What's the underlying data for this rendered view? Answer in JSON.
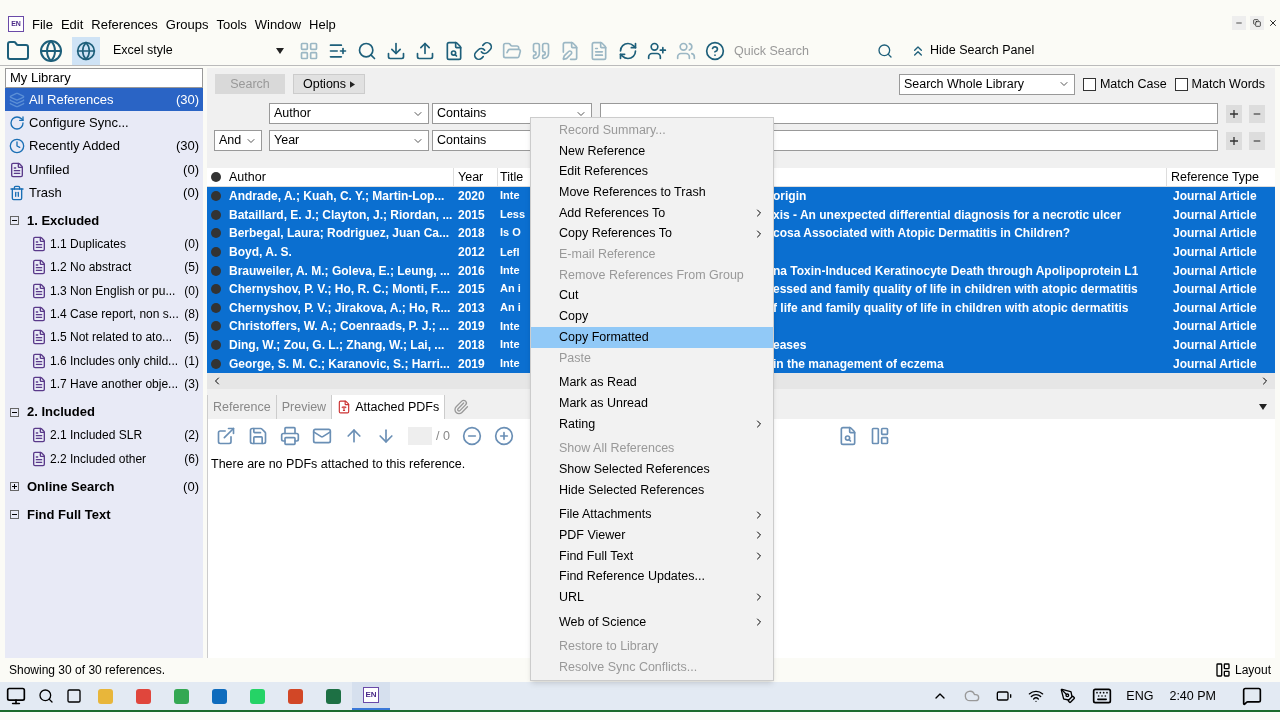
{
  "app_icon": "EN",
  "menu": [
    "File",
    "Edit",
    "References",
    "Groups",
    "Tools",
    "Window",
    "Help"
  ],
  "toolbar": {
    "style": "Excel style",
    "quick_search_placeholder": "Quick Search",
    "hide_search_panel": "Hide Search Panel"
  },
  "sidebar": {
    "header": "My Library",
    "items": [
      {
        "kind": "all",
        "label": "All References",
        "count": "(30)",
        "selected": true
      },
      {
        "kind": "sync",
        "label": "Configure Sync...",
        "selected": false
      },
      {
        "kind": "recent",
        "label": "Recently Added",
        "count": "(30)",
        "selected": false
      },
      {
        "kind": "unfiled",
        "label": "Unfiled",
        "count": "(0)",
        "selected": false
      },
      {
        "kind": "trash",
        "label": "Trash",
        "count": "(0)",
        "selected": false
      },
      {
        "kind": "set",
        "label": "1. Excluded",
        "expanded": true,
        "children": [
          {
            "label": "1.1 Duplicates",
            "count": "(0)"
          },
          {
            "label": "1.2 No abstract",
            "count": "(5)"
          },
          {
            "label": "1.3 Non English or pu...",
            "count": "(0)"
          },
          {
            "label": "1.4 Case report, non s...",
            "count": "(8)"
          },
          {
            "label": "1.5 Not related to ato...",
            "count": "(5)"
          },
          {
            "label": "1.6 Includes only child...",
            "count": "(1)"
          },
          {
            "label": "1.7 Have another obje...",
            "count": "(3)"
          }
        ]
      },
      {
        "kind": "set",
        "label": "2. Included",
        "expanded": true,
        "children": [
          {
            "label": "2.1 Included SLR",
            "count": "(2)"
          },
          {
            "label": "2.2 Included other",
            "count": "(6)"
          }
        ]
      },
      {
        "kind": "set",
        "label": "Online Search",
        "count": "(0)",
        "expanded": false
      },
      {
        "kind": "set",
        "label": "Find Full Text",
        "expanded": true
      }
    ]
  },
  "search_panel": {
    "search_button": "Search",
    "options_button": "Options",
    "scope": "Search Whole Library",
    "match_case": {
      "label": "Match Case",
      "checked": false
    },
    "match_words": {
      "label": "Match Words",
      "checked": false
    },
    "criteria": [
      {
        "field": "Author",
        "operator": "Contains"
      },
      {
        "connector": "And",
        "field": "Year",
        "operator": "Contains"
      }
    ]
  },
  "table": {
    "columns": [
      "Author",
      "Year",
      "Title",
      "Reference Type"
    ],
    "rows": [
      {
        "author": "Andrade, A.; Kuah, C. Y.; Martin-Lop...",
        "year": "2020",
        "title_start": "Inte",
        "title_end": "origin",
        "type": "Journal Article",
        "selected": true
      },
      {
        "author": "Bataillard, E. J.; Clayton, J.; Riordan, ...",
        "year": "2015",
        "title_start": "Less",
        "title_end": "xis - An unexpected differential diagnosis for a necrotic ulcer",
        "type": "Journal Article",
        "selected": true
      },
      {
        "author": "Berbegal, Laura; Rodriguez, Juan Ca...",
        "year": "2018",
        "title_start": "Is O",
        "title_end": "cosa Associated with Atopic Dermatitis in Children?",
        "type": "Journal Article",
        "selected": true
      },
      {
        "author": "Boyd, A. S.",
        "year": "2012",
        "title_start": "Lefl",
        "type": "Journal Article",
        "selected": true
      },
      {
        "author": "Brauweiler, A. M.; Goleva, E.; Leung, ...",
        "year": "2016",
        "title_start": "Inte",
        "title_end": "na Toxin-Induced Keratinocyte Death through Apolipoprotein L1",
        "type": "Journal Article",
        "selected": true
      },
      {
        "author": "Chernyshov, P. V.; Ho, R. C.; Monti, F....",
        "year": "2015",
        "title_start": "An i",
        "title_end": "essed and family quality of life in children with atopic dermatitis",
        "type": "Journal Article",
        "selected": true
      },
      {
        "author": "Chernyshov, P. V.; Jirakova, A.; Ho, R...",
        "year": "2013",
        "title_start": "An i",
        "title_end": "f life and family quality of life in children with atopic dermatitis",
        "type": "Journal Article",
        "selected": true
      },
      {
        "author": "Christoffers, W. A.; Coenraads, P. J.; ...",
        "year": "2019",
        "title_start": "Inte",
        "type": "Journal Article",
        "selected": true
      },
      {
        "author": "Ding, W.; Zou, G. L.; Zhang, W.; Lai, ...",
        "year": "2018",
        "title_start": "Inte",
        "title_end": "eases",
        "type": "Journal Article",
        "selected": true
      },
      {
        "author": "George, S. M. C.; Karanovic, S.; Harri...",
        "year": "2019",
        "title_start": "Inte",
        "title_end": "in the management of eczema",
        "type": "Journal Article",
        "selected": true
      }
    ]
  },
  "bottom_tabs": [
    {
      "label": "Reference",
      "selected": false
    },
    {
      "label": "Preview",
      "selected": false
    },
    {
      "label": "Attached PDFs",
      "selected": true
    }
  ],
  "pdf_page": "/ 0",
  "pdf_message": "There are no PDFs attached to this reference.",
  "context_menu": [
    {
      "kind": "item",
      "label": "Record Summary...",
      "disabled": true
    },
    {
      "kind": "item",
      "label": "New Reference"
    },
    {
      "kind": "item",
      "label": "Edit References"
    },
    {
      "kind": "item",
      "label": "Move References to Trash"
    },
    {
      "kind": "item",
      "label": "Add References To",
      "submenu": true
    },
    {
      "kind": "item",
      "label": "Copy References To",
      "submenu": true
    },
    {
      "kind": "item",
      "label": "E-mail Reference",
      "disabled": true
    },
    {
      "kind": "item",
      "label": "Remove References From Group",
      "disabled": true
    },
    {
      "kind": "item",
      "label": "Cut"
    },
    {
      "kind": "item",
      "label": "Copy"
    },
    {
      "kind": "item",
      "label": "Copy Formatted",
      "selected": true
    },
    {
      "kind": "item",
      "label": "Paste",
      "disabled": true
    },
    {
      "kind": "separator"
    },
    {
      "kind": "item",
      "label": "Mark as Read"
    },
    {
      "kind": "item",
      "label": "Mark as Unread"
    },
    {
      "kind": "item",
      "label": "Rating",
      "submenu": true
    },
    {
      "kind": "separator"
    },
    {
      "kind": "item",
      "label": "Show All References",
      "disabled": true
    },
    {
      "kind": "item",
      "label": "Show Selected References"
    },
    {
      "kind": "item",
      "label": "Hide Selected References"
    },
    {
      "kind": "separator"
    },
    {
      "kind": "item",
      "label": "File Attachments",
      "submenu": true
    },
    {
      "kind": "item",
      "label": "PDF Viewer",
      "submenu": true
    },
    {
      "kind": "item",
      "label": "Find Full Text",
      "submenu": true
    },
    {
      "kind": "item",
      "label": "Find Reference Updates..."
    },
    {
      "kind": "item",
      "label": "URL",
      "submenu": true
    },
    {
      "kind": "separator"
    },
    {
      "kind": "item",
      "label": "Web of Science",
      "submenu": true
    },
    {
      "kind": "separator"
    },
    {
      "kind": "item",
      "label": "Restore to Library",
      "disabled": true
    },
    {
      "kind": "item",
      "label": "Resolve Sync Conflicts...",
      "disabled": true
    }
  ],
  "status": "Showing 30 of 30 references.",
  "layout_button": "Layout",
  "taskbar": {
    "apps": [
      {
        "kind": "explorer",
        "active": false
      },
      {
        "kind": "paint",
        "active": false
      },
      {
        "kind": "chrome",
        "active": false
      },
      {
        "kind": "outlook",
        "active": false
      },
      {
        "kind": "whatsapp",
        "active": false
      },
      {
        "kind": "powerpoint",
        "active": false
      },
      {
        "kind": "excel",
        "active": false
      },
      {
        "kind": "endnote",
        "label": "EN",
        "active": true
      }
    ],
    "language": "ENG",
    "time": "2:40 PM"
  }
}
